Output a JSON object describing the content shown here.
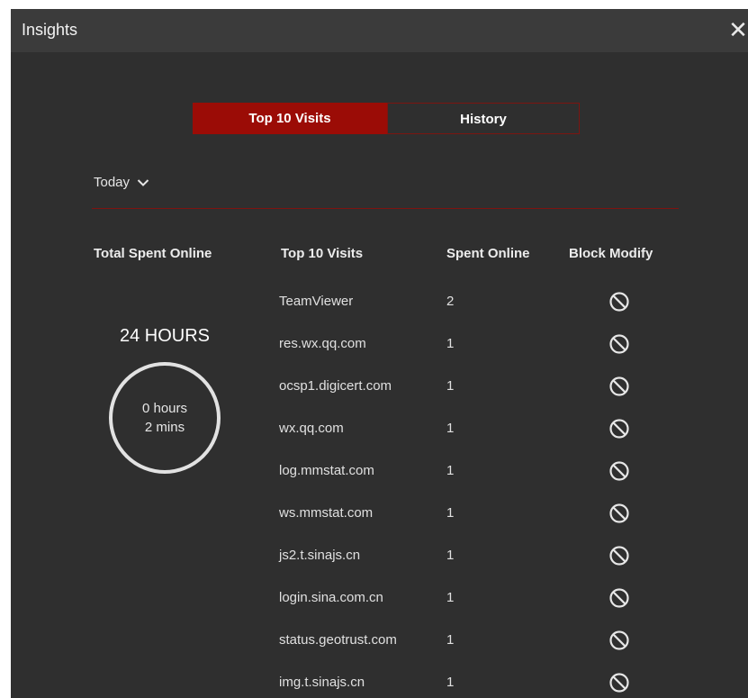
{
  "dialog": {
    "title": "Insights",
    "close_label": "✕"
  },
  "tabs": [
    {
      "label": "Top 10 Visits"
    },
    {
      "label": "History"
    }
  ],
  "period": {
    "selected": "Today"
  },
  "columns": {
    "total": "Total Spent Online",
    "visits": "Top 10 Visits",
    "spent": "Spent Online",
    "block": "Block Modify"
  },
  "summary": {
    "range": "24 HOURS",
    "hours": "0 hours",
    "mins": "2 mins"
  },
  "rows": [
    {
      "site": "TeamViewer",
      "count": "2"
    },
    {
      "site": "res.wx.qq.com",
      "count": "1"
    },
    {
      "site": "ocsp1.digicert.com",
      "count": "1"
    },
    {
      "site": "wx.qq.com",
      "count": "1"
    },
    {
      "site": "log.mmstat.com",
      "count": "1"
    },
    {
      "site": "ws.mmstat.com",
      "count": "1"
    },
    {
      "site": "js2.t.sinajs.cn",
      "count": "1"
    },
    {
      "site": "login.sina.com.cn",
      "count": "1"
    },
    {
      "site": "status.geotrust.com",
      "count": "1"
    },
    {
      "site": "img.t.sinajs.cn",
      "count": "1"
    }
  ],
  "icons": {
    "block": "block-icon",
    "dropdown": "chevron-down-icon",
    "close": "close-icon"
  },
  "colors": {
    "accent": "#9b0c06",
    "background": "#2f2f2f",
    "titlebar": "#3b3b3b"
  }
}
